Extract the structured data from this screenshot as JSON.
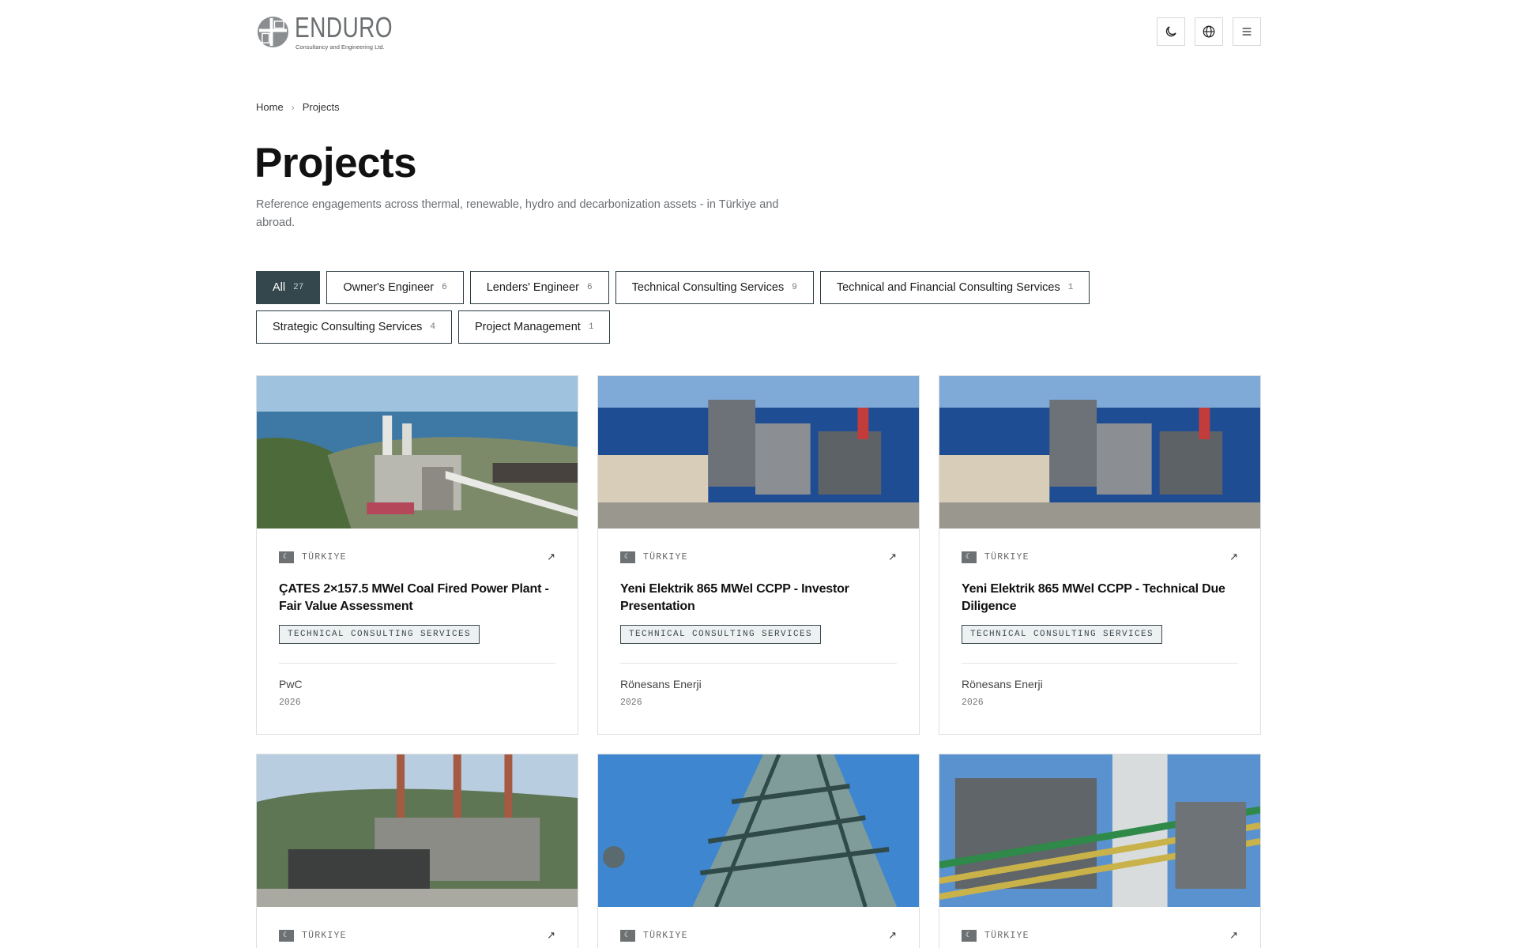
{
  "brand": {
    "name": "ENDURO",
    "tagline": "Consultancy and Engineering Ltd."
  },
  "header": {
    "icons": [
      "moon-icon",
      "globe-icon",
      "menu-icon"
    ]
  },
  "breadcrumb": {
    "home": "Home",
    "separator": "›",
    "current": "Projects"
  },
  "page": {
    "title": "Projects",
    "description": "Reference engagements across thermal, renewable, hydro and decarbonization assets - in Türkiye and abroad."
  },
  "filters": [
    {
      "label": "All",
      "count": "27",
      "active": true
    },
    {
      "label": "Owner's Engineer",
      "count": "6"
    },
    {
      "label": "Lenders' Engineer",
      "count": "6"
    },
    {
      "label": "Technical Consulting Services",
      "count": "9"
    },
    {
      "label": "Technical and Financial Consulting Services",
      "count": "1"
    },
    {
      "label": "Strategic Consulting Services",
      "count": "4"
    },
    {
      "label": "Project Management",
      "count": "1"
    }
  ],
  "projects": [
    {
      "country": "TÜRKIYE",
      "title": "ÇATES 2×157.5 MWel Coal Fired Power Plant - Fair Value Assessment",
      "tag": "TECHNICAL CONSULTING SERVICES",
      "client": "PwC",
      "year": "2026"
    },
    {
      "country": "TÜRKIYE",
      "title": "Yeni Elektrik 865 MWel CCPP - Investor Presentation",
      "tag": "TECHNICAL CONSULTING SERVICES",
      "client": "Rönesans Enerji",
      "year": "2026"
    },
    {
      "country": "TÜRKIYE",
      "title": "Yeni Elektrik 865 MWel CCPP - Technical Due Diligence",
      "tag": "TECHNICAL CONSULTING SERVICES",
      "client": "Rönesans Enerji",
      "year": "2026"
    },
    {
      "country": "TÜRKIYE"
    },
    {
      "country": "TÜRKIYE"
    },
    {
      "country": "TÜRKIYE"
    }
  ]
}
